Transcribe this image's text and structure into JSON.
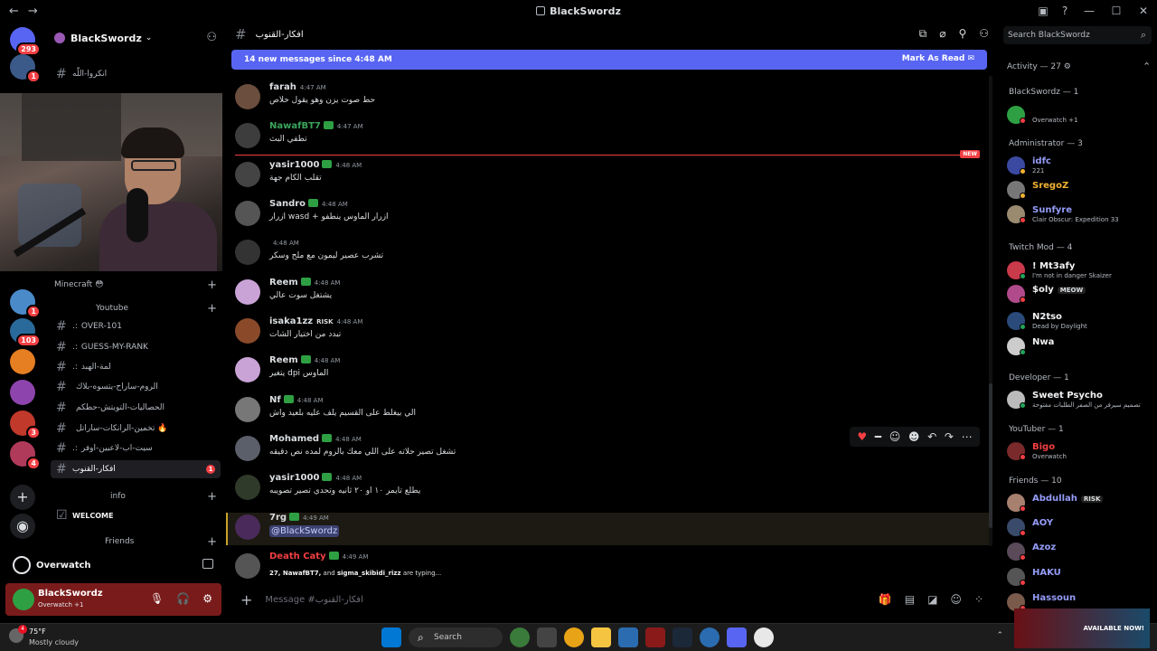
{
  "window": {
    "title": "BlackSwordz"
  },
  "server": {
    "name": "BlackSwordz",
    "rail_badges": [
      "293",
      "1",
      "1",
      "103",
      "3",
      "4"
    ]
  },
  "sidebar": {
    "top_channel": "انكروا-اللّه",
    "categories": {
      "minecraft": "Minecraft 😳",
      "youtube": "Youtube",
      "info": "info",
      "friends": "Friends"
    },
    "channels": [
      {
        "prefix": ".:",
        "label": "OVER-101"
      },
      {
        "prefix": ".:",
        "label": "GUESS-MY-RANK"
      },
      {
        "prefix": ".:",
        "label": "لمة-الهبد"
      },
      {
        "prefix": "",
        "label": "الروم-ساراح-يتسوه-بلاك"
      },
      {
        "prefix": "",
        "label": "الحصاليات-التويتش-حطكم"
      },
      {
        "prefix": "",
        "label": "تخمين-الرانكات-ساراتل 🔥"
      },
      {
        "prefix": ".:",
        "label": "سيت-اب-لاعبين-اوفر"
      },
      {
        "prefix": "",
        "label": "افكار-القنوب",
        "unread": "1"
      }
    ],
    "info_channel": "WELCOME"
  },
  "game_activity": "Overwatch",
  "user_panel": {
    "name": "BlackSwordz",
    "status": "Overwatch +1"
  },
  "chat": {
    "channel_name": "افكار-القنوب",
    "new_banner": "14 new messages since 4:48 AM",
    "mark_as_read": "Mark As Read",
    "new_label": "NEW",
    "messages": [
      {
        "author": "farah",
        "time": "4:47 AM",
        "text": "حط صوت يزن وهو يقول خلاص",
        "color": "#dbdee1",
        "avatar": "#6b4e3d"
      },
      {
        "author": "NawafBT7",
        "time": "4:47 AM",
        "text": "تطفي البث",
        "color": "#3ba55d",
        "avatar": "#3d3d3d"
      },
      {
        "author": "yasir1000",
        "time": "4:48 AM",
        "text": "تقلب الكام جهة",
        "color": "#dbdee1",
        "avatar": "#444"
      },
      {
        "author": "Sandro",
        "time": "4:48 AM",
        "text": "ازرار wasd + ازرار الماوس ينطفو",
        "color": "#dbdee1",
        "avatar": "#555"
      },
      {
        "author": "",
        "time": "4:48 AM",
        "text": "تشرب عصير ليمون مع ملح وسكر",
        "color": "#dbdee1",
        "avatar": "#333"
      },
      {
        "author": "Reem",
        "time": "4:48 AM",
        "text": "يشتغل سوت عالي",
        "color": "#dbdee1",
        "avatar": "#c9a3d6"
      },
      {
        "author": "isaka1zz",
        "time": "4:48 AM",
        "text": "تبدد من اختيار الشات",
        "color": "#dbdee1",
        "avatar": "#8a4a2a",
        "tag": "RISK"
      },
      {
        "author": "Reem",
        "time": "4:48 AM",
        "text": "يتغير dpi الماوس",
        "color": "#dbdee1",
        "avatar": "#c9a3d6"
      },
      {
        "author": "Nf",
        "time": "4:48 AM",
        "text": "الي بيغلط على القسيم يلف عليه بلعيد واش",
        "color": "#dbdee1",
        "avatar": "#777"
      },
      {
        "author": "Mohamed",
        "time": "4:48 AM",
        "text": "تشغل تصير حلاته على اللي معك بالروم لمده نص دقيقه",
        "color": "#dbdee1",
        "avatar": "#5a5f6a"
      },
      {
        "author": "yasir1000",
        "time": "4:48 AM",
        "text": "يطلع تايمر ١٠ او ٢٠ ثانيه وتحدي تصير تصويبه",
        "color": "#dbdee1",
        "avatar": "#2f3a2a"
      },
      {
        "author": "7rg",
        "time": "4:49 AM",
        "text": "@BlackSwordz",
        "color": "#dbdee1",
        "avatar": "#4a2a5a"
      },
      {
        "author": "Death Caty",
        "time": "4:49 AM",
        "text": "",
        "color": "#f23f43",
        "avatar": "#555"
      }
    ],
    "typing": {
      "users": "27, NawafBT7,",
      "and": "and",
      "last": "sigma_skibidi_rizz",
      "suffix": "are typing..."
    },
    "composer_placeholder": "Message #افكار-القنوب"
  },
  "members": {
    "search_placeholder": "Search BlackSwordz",
    "activity_header": "Activity — 27",
    "groups": [
      {
        "label": "BlackSwordz — 1"
      },
      {
        "label": "Administrator — 3"
      },
      {
        "label": "Twitch Mod — 4"
      },
      {
        "label": "Developer — 1"
      },
      {
        "label": "YouTuber — 1"
      },
      {
        "label": "Friends — 10"
      }
    ],
    "list": [
      {
        "name": "",
        "status": "Overwatch +1",
        "color": "#dbdee1",
        "avatar": "#2ea043",
        "dot": "#f23f43"
      },
      {
        "name": "idfc",
        "status": "221",
        "color": "#949cf7",
        "avatar": "#3b4aa0",
        "dot": "#f0b232"
      },
      {
        "name": "SregoZ",
        "status": "",
        "color": "#f0b232",
        "avatar": "#777",
        "dot": "#f0b232"
      },
      {
        "name": "Sunfyre",
        "status": "Clair Obscur: Expedition 33",
        "color": "#949cf7",
        "avatar": "#9a8a70",
        "dot": "#f23f43"
      },
      {
        "name": "! Mt3afy",
        "status": "I'm not in danger Skaizer",
        "color": "#f2f3f5",
        "avatar": "#c93a4a",
        "dot": "#23a55a"
      },
      {
        "name": "$oly",
        "status": "",
        "color": "#f2f3f5",
        "avatar": "#b04a8a",
        "dot": "#f23f43",
        "tag": "MEOW"
      },
      {
        "name": "N2tso",
        "status": "Dead by Daylight",
        "color": "#f2f3f5",
        "avatar": "#2a4a7a",
        "dot": "#23a55a"
      },
      {
        "name": "Nwa",
        "status": "",
        "color": "#f2f3f5",
        "avatar": "#ccc",
        "dot": "#23a55a"
      },
      {
        "name": "Sweet Psycho",
        "status": "تصميم سيرفر من الصفر الطلبات مفتوحة",
        "color": "#f2f3f5",
        "avatar": "#bbb",
        "dot": "#23a55a"
      },
      {
        "name": "Bigo",
        "status": "Overwatch",
        "color": "#f23f43",
        "avatar": "#7a2a2a",
        "dot": "#f23f43"
      },
      {
        "name": "Abdullah",
        "status": "",
        "color": "#949cf7",
        "avatar": "#a88070",
        "dot": "#f23f43",
        "tag": "RISK"
      },
      {
        "name": "AOY",
        "status": "",
        "color": "#949cf7",
        "avatar": "#3a4a6a",
        "dot": "#f23f43"
      },
      {
        "name": "Azoz",
        "status": "",
        "color": "#949cf7",
        "avatar": "#5a4a5a",
        "dot": "#f23f43"
      },
      {
        "name": "HAKU",
        "status": "",
        "color": "#949cf7",
        "avatar": "#555",
        "dot": "#f23f43"
      },
      {
        "name": "Hassoun",
        "status": "",
        "color": "#949cf7",
        "avatar": "#7a5a4a",
        "dot": "#f23f43"
      }
    ]
  },
  "taskbar": {
    "temp": "75°F",
    "condition": "Mostly cloudy",
    "weather_badge": "4",
    "search": "Search",
    "ad_text": "AVAILABLE NOW!"
  }
}
